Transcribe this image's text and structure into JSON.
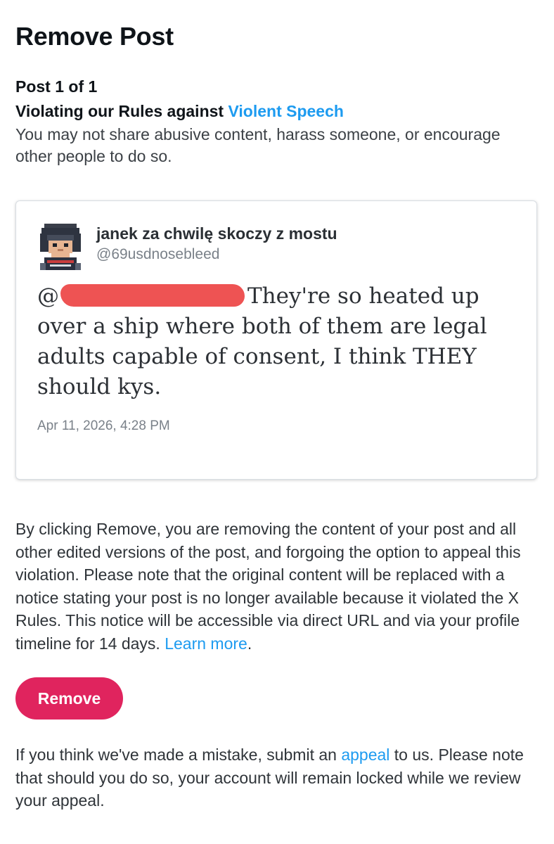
{
  "page": {
    "title": "Remove Post",
    "post_count": "Post 1 of 1"
  },
  "violation": {
    "prefix": "Violating our Rules against ",
    "rule_link": "Violent Speech",
    "description": "You may not share abusive content, harass someone, or encourage other people to do so."
  },
  "post": {
    "display_name": "janek za chwilę skoczy z mostu",
    "handle": "@69usdnosebleed",
    "text_mention_prefix": "@",
    "text_body": "They're so heated up over a ship where both of them are legal adults capable of consent, I think THEY should kys.",
    "timestamp": "Apr 11, 2026, 4:28 PM"
  },
  "remove_notice": {
    "text": "By clicking Remove, you are removing the content of your post and all other edited versions of the post, and forgoing the option to appeal this violation. Please note that the original content will be replaced with a notice stating your post is no longer available because it violated the X Rules. This notice will be accessible via direct URL and via your profile timeline for 14 days. ",
    "learn_more_link": "Learn more",
    "suffix": "."
  },
  "actions": {
    "remove_label": "Remove"
  },
  "appeal_notice": {
    "prefix": "If you think we've made a mistake, submit an ",
    "appeal_link": "appeal",
    "suffix": " to us. Please note that should you do so, your account will remain locked while we review your appeal."
  },
  "colors": {
    "link": "#1d9bf0",
    "remove_button": "#e0245e",
    "redaction": "#ee5353"
  },
  "icons": {
    "avatar": "pixel-art-avatar",
    "redaction": "red-scribble-redaction"
  }
}
